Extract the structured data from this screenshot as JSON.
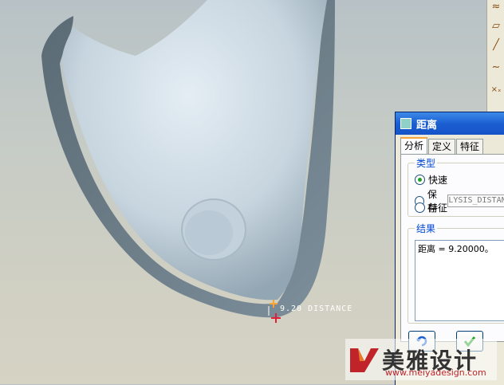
{
  "dialog": {
    "title": "距离",
    "tabs": [
      "分析",
      "定义",
      "特征"
    ],
    "active_tab": "分析",
    "type_group": {
      "label": "类型",
      "options": [
        "快速",
        "保存",
        "特征"
      ],
      "selected": "快速",
      "name_value": "LYSIS_DISTAN"
    },
    "result_group": {
      "label": "结果",
      "text": "距离 = 9.20000。"
    }
  },
  "viewport": {
    "dimension_label": "9.20  DISTANCE"
  },
  "watermark": {
    "brand": "美雅设计",
    "url": "www.meiyadesign.com"
  },
  "colors": {
    "accent_orange": "#f5a53a",
    "title_blue": "#1c5fd2",
    "marker_red": "#e0203a"
  }
}
